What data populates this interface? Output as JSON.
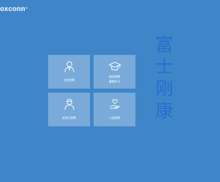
{
  "header": {
    "logo_text": "oxconn",
    "logo_mark": "®"
  },
  "tiles": [
    {
      "label": "社会招聘",
      "sublabel": "",
      "icon": "person-icon"
    },
    {
      "label": "校园招聘",
      "sublabel": "暑期实习",
      "icon": "graduation-cap-icon"
    },
    {
      "label": "其他工招聘",
      "sublabel": "",
      "icon": "worker-icon"
    },
    {
      "label": "公益招聘",
      "sublabel": "",
      "icon": "charity-hand-icon"
    }
  ],
  "slogan": [
    "富",
    "士",
    "刚",
    "康"
  ],
  "colors": {
    "background": "#3f86c9",
    "tile_bg": "rgba(255,255,255,0.30)",
    "slogan": "#1f6bd1"
  }
}
